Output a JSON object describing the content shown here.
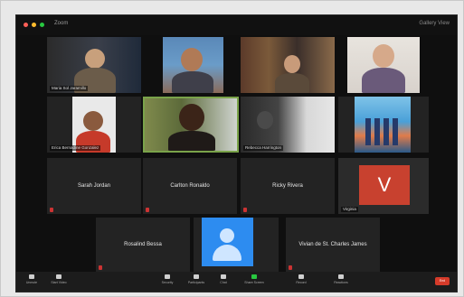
{
  "window": {
    "title": "Zoom",
    "view_label": "Gallery View"
  },
  "tiles_row1": [
    {
      "name": "Maria Sol Jaramillo"
    },
    {
      "name": ""
    },
    {
      "name": ""
    },
    {
      "name": ""
    }
  ],
  "tiles_row2": [
    {
      "name": "Erica Bernadine Gonzalez"
    },
    {
      "name": ""
    },
    {
      "name": "Rebecca Harrington"
    },
    {
      "name": ""
    }
  ],
  "tiles_row3": [
    {
      "name": "Sarah Jordan"
    },
    {
      "name": "Carlton Ronaldo"
    },
    {
      "name": "Ricky Rivera"
    },
    {
      "name": "Virginia"
    }
  ],
  "tiles_row4": [
    {
      "name": "Rosalind Bessa"
    },
    {
      "name": ""
    },
    {
      "name": "Vivian de St. Charles James"
    }
  ],
  "avatar_letter": "V",
  "toolbar": {
    "items": [
      "Unmute",
      "Start Video",
      "Security",
      "Participants",
      "Chat",
      "Share Screen",
      "Record",
      "Reactions"
    ],
    "end_label": "End"
  },
  "colors": {
    "avatar_red": "#c8412f",
    "avatar_blue": "#2d8cf0",
    "active_speaker": "#7aa34a",
    "end_red": "#d53b2a"
  }
}
